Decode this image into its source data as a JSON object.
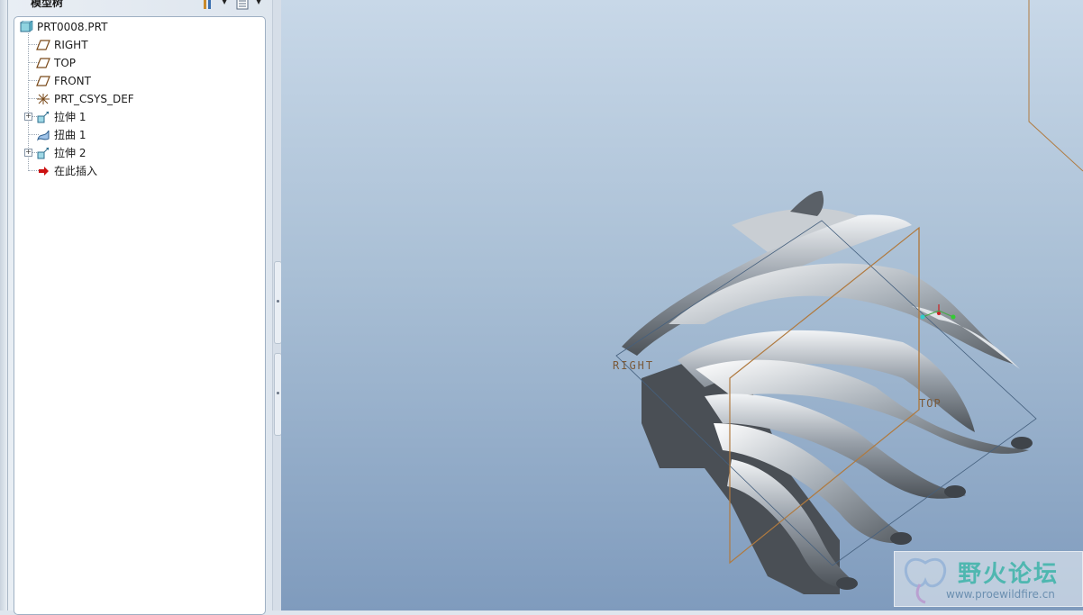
{
  "panel": {
    "title": "模型树"
  },
  "tree": {
    "root": "PRT0008.PRT",
    "items": [
      {
        "label": "RIGHT",
        "icon": "datum-plane-icon"
      },
      {
        "label": "TOP",
        "icon": "datum-plane-icon"
      },
      {
        "label": "FRONT",
        "icon": "datum-plane-icon"
      },
      {
        "label": "PRT_CSYS_DEF",
        "icon": "coordinate-system-icon"
      },
      {
        "label": "拉伸 1",
        "icon": "extrude-icon"
      },
      {
        "label": "扭曲 1",
        "icon": "warp-icon"
      },
      {
        "label": "拉伸 2",
        "icon": "extrude-icon"
      },
      {
        "label": "在此插入",
        "icon": "insert-here-arrow-icon"
      }
    ]
  },
  "viewport": {
    "datum_labels": {
      "right": "RIGHT",
      "top": "TOP"
    }
  },
  "watermark": {
    "title": "野火论坛",
    "url": "www.proewildfire.cn"
  },
  "colors": {
    "datum": "#b07a3f",
    "accent": "#4fb7b0",
    "insert_arrow": "#cc1111"
  }
}
